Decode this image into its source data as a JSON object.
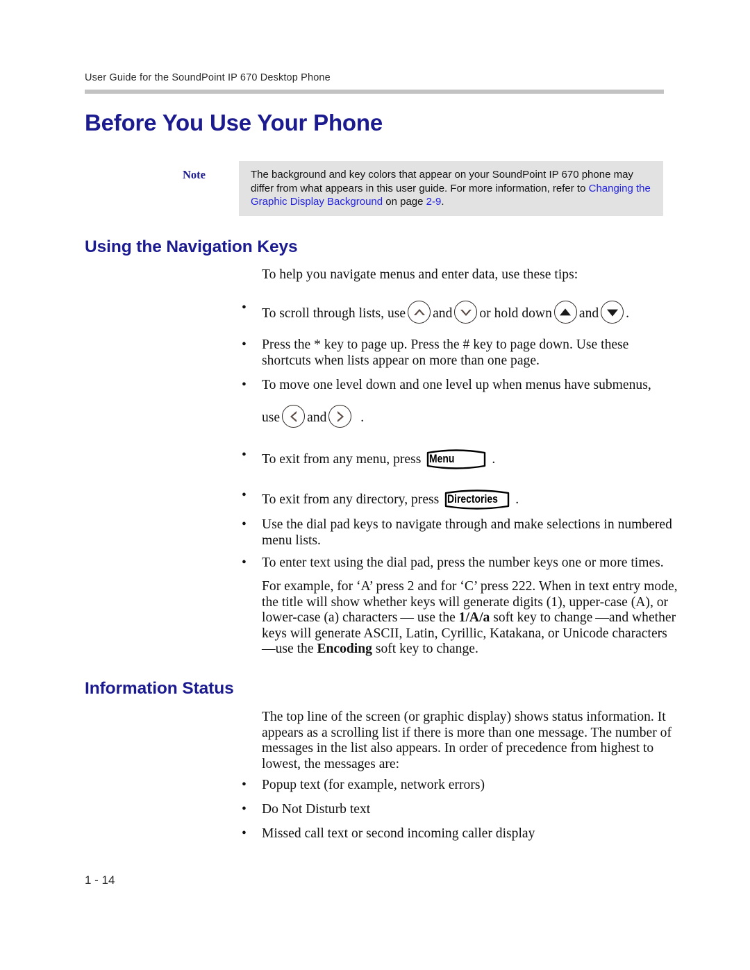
{
  "header": {
    "running_header": "User Guide for the SoundPoint IP 670 Desktop Phone"
  },
  "chapter": {
    "title": "Before You Use Your Phone"
  },
  "note": {
    "label": "Note",
    "text_part1": "The background and key colors that appear on your SoundPoint IP 670 phone may differ from what appears in this user guide. For more information, refer to ",
    "link_text": "Changing the Graphic Display Background",
    "text_part2": " on page ",
    "page_ref": "2-9",
    "text_part3": ".",
    "background_color": "#e2e2e2",
    "link_color": "#2222dd"
  },
  "sections": [
    {
      "heading": "Using the Navigation Keys",
      "intro": "To help you navigate menus and enter data, use these tips:",
      "bullets": [
        {
          "id": "scroll-lists",
          "bullet_char": "•",
          "text_before": "To scroll through lists, use",
          "and_1": "and",
          "text_middle": "or hold down",
          "and_2": "and",
          "text_after": ".",
          "icons": [
            "arrow-up-hollow-icon",
            "arrow-down-hollow-icon",
            "arrow-up-solid-icon",
            "arrow-down-solid-icon"
          ]
        },
        {
          "id": "page-up-down",
          "bullet_char": "•",
          "line1": "Press the * key to page up. Press the # key to page down. Use these",
          "line2": "shortcuts when lists appear on more than one page."
        },
        {
          "id": "move-level",
          "bullet_char": "•",
          "line1": "To move one level down and one level up when menus have submenus,",
          "use_label": "use",
          "and_label": "and",
          "text_after": ".",
          "icons": [
            "arrow-left-hollow-icon",
            "arrow-right-hollow-icon"
          ]
        },
        {
          "id": "exit-menu",
          "bullet_char": "•",
          "text_before": "To exit from any menu, press",
          "key_label": "Menu",
          "text_after": "."
        },
        {
          "id": "exit-directory",
          "bullet_char": "•",
          "text_before": "To exit from any directory, press",
          "key_label": "Directories",
          "text_after": "."
        },
        {
          "id": "dial-pad-nav",
          "bullet_char": "•",
          "line1": "Use the dial pad keys to navigate through and make selections in",
          "line2": "numbered menu lists."
        },
        {
          "id": "enter-text",
          "bullet_char": "•",
          "line1": "To enter text using the dial pad, press the number keys one or more times."
        }
      ],
      "paragraph": {
        "p1": "For example, for ‘A’ press 2 and for ‘C’ press 222. When in text entry mode, the title will show whether keys will generate digits (1), upper-case (A), or lower-case (a) characters — use the ",
        "bold1": "1/A/a",
        "p2": " soft key to change —and whether keys will generate ASCII, Latin, Cyrillic, Katakana, or Unicode characters —use the ",
        "bold2": "Encoding",
        "p3": " soft key to change."
      }
    },
    {
      "heading": "Information Status",
      "intro": "The top line of the screen (or graphic display) shows status information. It appears as a scrolling list if there is more than one message. The number of messages in the list also appears. In order of precedence from highest to lowest, the messages are:",
      "bullets": [
        {
          "id": "popup-text",
          "bullet_char": "•",
          "line1": "Popup text (for example, network errors)"
        },
        {
          "id": "dnd-text",
          "bullet_char": "•",
          "line1": "Do Not Disturb text"
        },
        {
          "id": "missed-call-text",
          "bullet_char": "•",
          "line1": "Missed call text or second incoming caller display"
        }
      ]
    }
  ],
  "footer": {
    "page_number": "1 - 14"
  },
  "colors": {
    "heading_blue": "#1b1b8f",
    "rule_gray": "#c2c2c2"
  }
}
